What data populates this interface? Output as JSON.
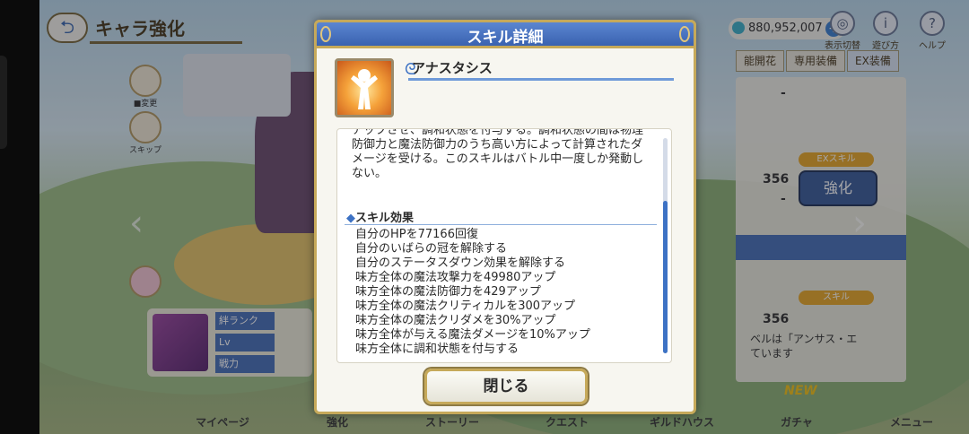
{
  "header": {
    "title": "キャラ強化",
    "back_icon": "back-arrow-icon",
    "gem_amount": "880,952,007",
    "icons": [
      {
        "label": "表示切替",
        "icon": "display-toggle-icon"
      },
      {
        "label": "遊び方",
        "icon": "info-icon"
      },
      {
        "label": "ヘルプ",
        "icon": "help-icon"
      }
    ]
  },
  "tabs": [
    "能開花",
    "専用装備",
    "EX装備"
  ],
  "right_panel": {
    "dash1": "-",
    "value1": "356",
    "dash2": "-",
    "ex_skill_tag": "EXスキル",
    "enhance_button": "強化",
    "value2": "356",
    "skill_tag": "スキル",
    "text1": "ベルは「アンサス・エ",
    "text2": "ています"
  },
  "side_icons": [
    "■変更",
    "スキップ"
  ],
  "char_card": {
    "stats": [
      "絆ランク",
      "Lv",
      "戦力"
    ]
  },
  "bottom_nav": [
    "マイページ",
    "強化",
    "ストーリー",
    "クエスト",
    "ギルドハウス",
    "ガチャ",
    "メニュー"
  ],
  "new_badge": "NEW",
  "modal": {
    "title": "スキル詳細",
    "skill_name": "アナスタシス",
    "description": "アップさせ、調和状態を付与する。調和状態の間は物理防御力と魔法防御力のうち高い方によって計算されたダメージを受ける。このスキルはバトル中一度しか発動しない。",
    "effects_heading": "スキル効果",
    "effects": [
      "自分のHPを77166回復",
      "自分のいばらの冠を解除する",
      "自分のステータスダウン効果を解除する",
      "味方全体の魔法攻撃力を49980アップ",
      "味方全体の魔法防御力を429アップ",
      "味方全体の魔法クリティカルを300アップ",
      "味方全体の魔法クリダメを30%アップ",
      "味方全体が与える魔法ダメージを10%アップ",
      "味方全体に調和状態を付与する"
    ],
    "close_label": "閉じる",
    "skill_icon": "heal-burst-icon"
  },
  "colors": {
    "header_blue": "#3a62b0",
    "gold_border": "#c6a95a",
    "accent_blue": "#3d72c4"
  }
}
